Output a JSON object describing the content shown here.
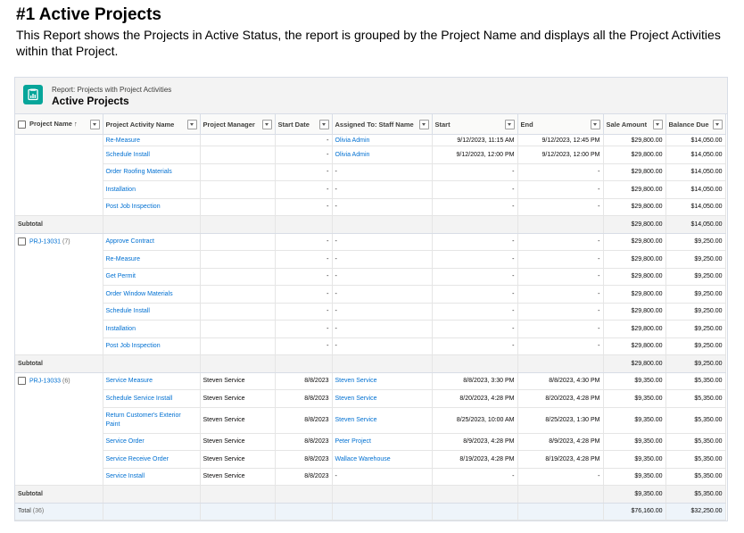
{
  "doc": {
    "title": "#1 Active Projects",
    "description": "This Report shows the Projects in Active Status, the report is grouped by the Project Name and displays all the Project Activities within that Project."
  },
  "report": {
    "subtitle": "Report: Projects with Project Activities",
    "title": "Active Projects",
    "icon": "report-icon",
    "accent_color": "#06a59a",
    "link_color": "#0070d2"
  },
  "columns": [
    "Project Name",
    "Project Activity Name",
    "Project Manager",
    "Start Date",
    "Assigned To: Staff Name",
    "Start",
    "End",
    "Sale Amount",
    "Balance Due"
  ],
  "sort_indicator": "↑",
  "groups": [
    {
      "name": "",
      "count": "",
      "rows": [
        {
          "activity": "Re-Measure",
          "manager": "",
          "start_date": "-",
          "staff": "Olivia Admin",
          "start": "9/12/2023, 11:15 AM",
          "end": "9/12/2023, 12:45 PM",
          "sale": "$29,800.00",
          "balance": "$14,050.00"
        },
        {
          "activity": "Schedule Install",
          "manager": "",
          "start_date": "-",
          "staff": "Olivia Admin",
          "start": "9/12/2023, 12:00 PM",
          "end": "9/12/2023, 12:00 PM",
          "sale": "$29,800.00",
          "balance": "$14,050.00"
        },
        {
          "activity": "Order Roofing Materials",
          "manager": "",
          "start_date": "-",
          "staff": "-",
          "start": "-",
          "end": "-",
          "sale": "$29,800.00",
          "balance": "$14,050.00"
        },
        {
          "activity": "Installation",
          "manager": "",
          "start_date": "-",
          "staff": "-",
          "start": "-",
          "end": "-",
          "sale": "$29,800.00",
          "balance": "$14,050.00"
        },
        {
          "activity": "Post Job Inspection",
          "manager": "",
          "start_date": "-",
          "staff": "-",
          "start": "-",
          "end": "-",
          "sale": "$29,800.00",
          "balance": "$14,050.00"
        }
      ],
      "subtotal": {
        "label": "Subtotal",
        "sale": "$29,800.00",
        "balance": "$14,050.00"
      }
    },
    {
      "name": "PRJ-13031",
      "count": "(7)",
      "rows": [
        {
          "activity": "Approve Contract",
          "manager": "",
          "start_date": "-",
          "staff": "-",
          "start": "-",
          "end": "-",
          "sale": "$29,800.00",
          "balance": "$9,250.00"
        },
        {
          "activity": "Re-Measure",
          "manager": "",
          "start_date": "-",
          "staff": "-",
          "start": "-",
          "end": "-",
          "sale": "$29,800.00",
          "balance": "$9,250.00"
        },
        {
          "activity": "Get Permit",
          "manager": "",
          "start_date": "-",
          "staff": "-",
          "start": "-",
          "end": "-",
          "sale": "$29,800.00",
          "balance": "$9,250.00"
        },
        {
          "activity": "Order Window Materials",
          "manager": "",
          "start_date": "-",
          "staff": "-",
          "start": "-",
          "end": "-",
          "sale": "$29,800.00",
          "balance": "$9,250.00"
        },
        {
          "activity": "Schedule Install",
          "manager": "",
          "start_date": "-",
          "staff": "-",
          "start": "-",
          "end": "-",
          "sale": "$29,800.00",
          "balance": "$9,250.00"
        },
        {
          "activity": "Installation",
          "manager": "",
          "start_date": "-",
          "staff": "-",
          "start": "-",
          "end": "-",
          "sale": "$29,800.00",
          "balance": "$9,250.00"
        },
        {
          "activity": "Post Job Inspection",
          "manager": "",
          "start_date": "-",
          "staff": "-",
          "start": "-",
          "end": "-",
          "sale": "$29,800.00",
          "balance": "$9,250.00"
        }
      ],
      "subtotal": {
        "label": "Subtotal",
        "sale": "$29,800.00",
        "balance": "$9,250.00"
      }
    },
    {
      "name": "PRJ-13033",
      "count": "(6)",
      "rows": [
        {
          "activity": "Service Measure",
          "manager": "Steven Service",
          "start_date": "8/8/2023",
          "staff": "Steven Service",
          "start": "8/8/2023, 3:30 PM",
          "end": "8/8/2023, 4:30 PM",
          "sale": "$9,350.00",
          "balance": "$5,350.00"
        },
        {
          "activity": "Schedule Service Install",
          "manager": "Steven Service",
          "start_date": "8/8/2023",
          "staff": "Steven Service",
          "start": "8/20/2023, 4:28 PM",
          "end": "8/20/2023, 4:28 PM",
          "sale": "$9,350.00",
          "balance": "$5,350.00"
        },
        {
          "activity": "Return Customer's Exterior Paint",
          "manager": "Steven Service",
          "start_date": "8/8/2023",
          "staff": "Steven Service",
          "start": "8/25/2023, 10:00 AM",
          "end": "8/25/2023, 1:30 PM",
          "sale": "$9,350.00",
          "balance": "$5,350.00"
        },
        {
          "activity": "Service Order",
          "manager": "Steven Service",
          "start_date": "8/8/2023",
          "staff": "Peter Project",
          "start": "8/9/2023, 4:28 PM",
          "end": "8/9/2023, 4:28 PM",
          "sale": "$9,350.00",
          "balance": "$5,350.00"
        },
        {
          "activity": "Service Receive Order",
          "manager": "Steven Service",
          "start_date": "8/8/2023",
          "staff": "Wallace Warehouse",
          "start": "8/19/2023, 4:28 PM",
          "end": "8/19/2023, 4:28 PM",
          "sale": "$9,350.00",
          "balance": "$5,350.00"
        },
        {
          "activity": "Service Install",
          "manager": "Steven Service",
          "start_date": "8/8/2023",
          "staff": "-",
          "start": "-",
          "end": "-",
          "sale": "$9,350.00",
          "balance": "$5,350.00"
        }
      ],
      "subtotal": {
        "label": "Subtotal",
        "sale": "$9,350.00",
        "balance": "$5,350.00"
      }
    }
  ],
  "total": {
    "label": "Total",
    "count": "(36)",
    "sale": "$76,160.00",
    "balance": "$32,250.00"
  }
}
